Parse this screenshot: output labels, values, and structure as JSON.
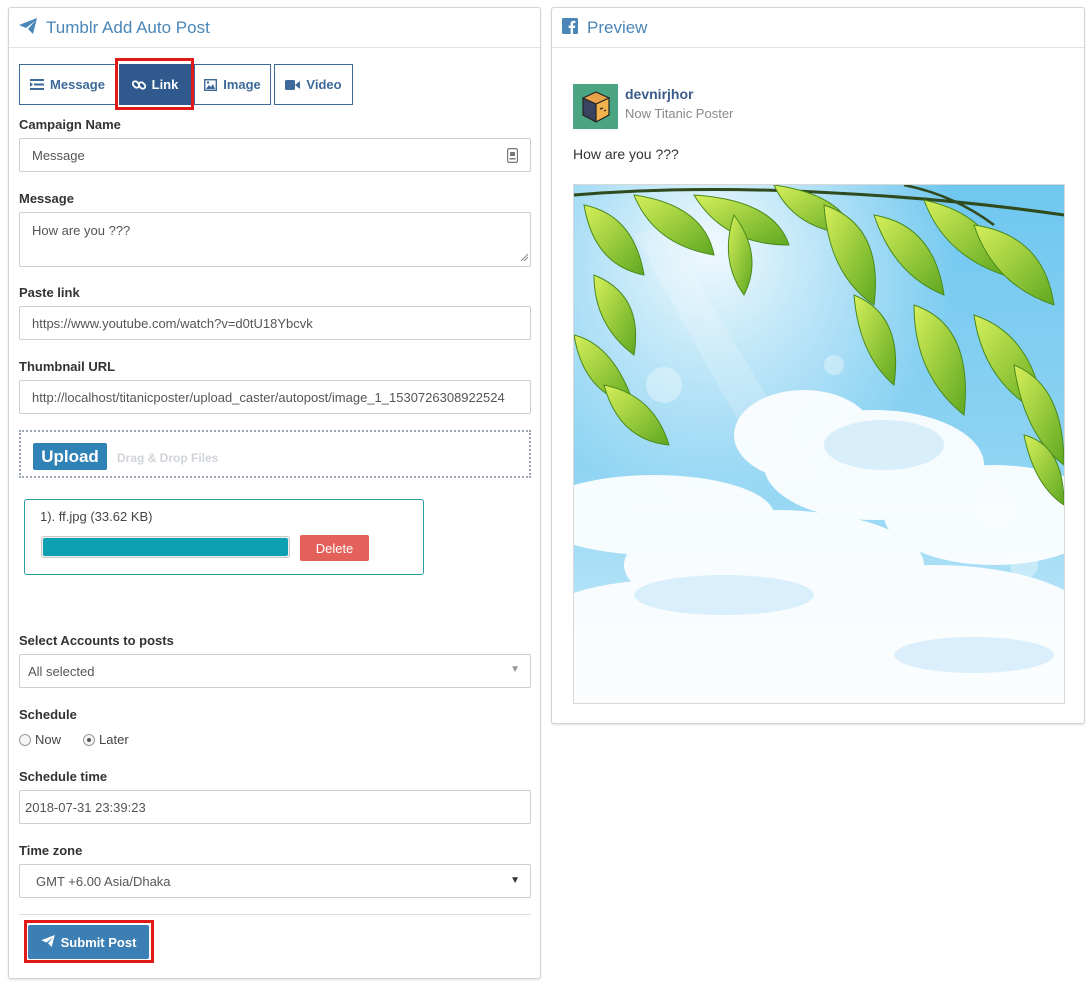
{
  "left_panel": {
    "title": "Tumblr Add Auto Post",
    "tabs": [
      {
        "label": "Message",
        "icon": "list-icon"
      },
      {
        "label": "Link",
        "icon": "link-icon",
        "active": true
      },
      {
        "label": "Image",
        "icon": "image-icon"
      },
      {
        "label": "Video",
        "icon": "video-icon"
      }
    ],
    "campaign": {
      "label": "Campaign Name",
      "value": "Message"
    },
    "message": {
      "label": "Message",
      "value": "How are you ???"
    },
    "paste_link": {
      "label": "Paste link",
      "value": "https://www.youtube.com/watch?v=d0tU18Ybcvk"
    },
    "thumbnail": {
      "label": "Thumbnail URL",
      "value": "http://localhost/titanicposter/upload_caster/autopost/image_1_1530726308922524"
    },
    "upload": {
      "button": "Upload",
      "hint": "Drag & Drop Files"
    },
    "file": {
      "name": "1). ff.jpg (33.62 KB)",
      "progress": 1.0,
      "delete_label": "Delete"
    },
    "accounts": {
      "label": "Select Accounts to posts",
      "value": "All selected"
    },
    "schedule": {
      "label": "Schedule",
      "options": [
        "Now",
        "Later"
      ],
      "selected": "Later"
    },
    "schedule_time": {
      "label": "Schedule time",
      "value": "2018-07-31 23:39:23"
    },
    "timezone": {
      "label": "Time zone",
      "value": "GMT +6.00 Asia/Dhaka"
    },
    "submit_label": "Submit Post"
  },
  "preview": {
    "title": "Preview",
    "user_name": "devnirjhor",
    "user_sub": "Now Titanic Poster",
    "message": "How are you ???"
  },
  "colors": {
    "accent": "#305a8d",
    "highlight": "#e01919",
    "title": "#4a86b8"
  }
}
